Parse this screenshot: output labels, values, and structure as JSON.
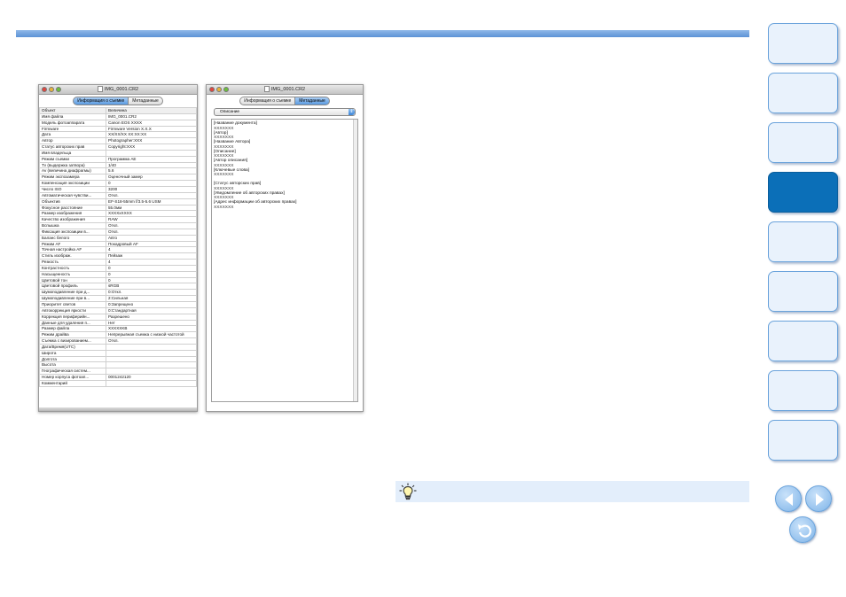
{
  "window1": {
    "title": "IMG_0001.CR2",
    "tabs": [
      "Информация о съемке",
      "Метаданные"
    ],
    "active_tab": 0,
    "columns": [
      "Объект",
      "Величина"
    ],
    "rows": [
      [
        "Имя файла",
        "IMG_0001.CR2"
      ],
      [
        "Модель фотоаппарата",
        "Canon EOS XXXX"
      ],
      [
        "Firmware",
        "Firmware Version X.X.X"
      ],
      [
        "Дата",
        "XX/XX/XX XX:XX:XX"
      ],
      [
        "Автор",
        "Photographer:XXX"
      ],
      [
        "Статус авторских прав",
        "Copyright:XXX"
      ],
      [
        "Имя владельца",
        ""
      ],
      [
        "Режим съемки",
        "Программа AE"
      ],
      [
        "Tv (выдержка затвора)",
        "1/40"
      ],
      [
        "Av (величина диафрагмы)",
        "5.6"
      ],
      [
        "Режим экспозамера",
        "Оценочный замер"
      ],
      [
        "Компенсация экспозиции",
        "0"
      ],
      [
        "Число ISO",
        "3200"
      ],
      [
        "Автоматическая чувстви...",
        "Откл."
      ],
      [
        "Объектив",
        "EF-S18-55mm f/3.5-5.6 USM"
      ],
      [
        "Фокусное расстояние",
        "55.0мм"
      ],
      [
        "Размер изображения",
        "XXXXxXXXX"
      ],
      [
        "Качество изображения",
        "RAW"
      ],
      [
        "Вспышка",
        "Откл."
      ],
      [
        "Фиксация экспозиции в...",
        "Откл."
      ],
      [
        "Баланс белого",
        "Авто"
      ],
      [
        "Режим AF",
        "Покадровый AF"
      ],
      [
        "Точная настройка AF",
        "4"
      ],
      [
        "Стиль изображ.",
        "Пейзаж"
      ],
      [
        "Резкость",
        "4"
      ],
      [
        "Контрастность",
        "0"
      ],
      [
        "Насыщенность",
        "0"
      ],
      [
        "Цветовой тон",
        "0"
      ],
      [
        "Цветовой профиль",
        "sRGB"
      ],
      [
        "Шумоподавление при д...",
        "0:Откл."
      ],
      [
        "Шумоподавление при в...",
        "2:Сильная"
      ],
      [
        "Приоритет светов",
        "0:Запрещено"
      ],
      [
        "Автокоррекция яркости",
        "0:Стандартная"
      ],
      [
        "Коррекция периферийн...",
        "Разрешено"
      ],
      [
        "Данные для удаления п...",
        "Нет"
      ],
      [
        "Размер файла",
        "XXXXXKB"
      ],
      [
        "Режим драйва",
        "Непрерывная съемка с низкой частотой"
      ],
      [
        "Съемка с визированием...",
        "Откл."
      ],
      [
        "Дата/Время(UTC)",
        ""
      ],
      [
        "Широта",
        ""
      ],
      [
        "Долгота",
        ""
      ],
      [
        "Высота",
        ""
      ],
      [
        "Географическая систем...",
        ""
      ],
      [
        "Номер корпуса фотоап...",
        "0001242120"
      ],
      [
        "Комментарий",
        ""
      ]
    ]
  },
  "window2": {
    "title": "IMG_0001.CR2",
    "tabs": [
      "Информация о съемке",
      "Метаданные"
    ],
    "active_tab": 1,
    "dropdown": "Описание",
    "fields": [
      {
        "label": "[Название документа]",
        "value": "XXXXXXX"
      },
      {
        "label": "[Автор]",
        "value": "XXXXXXX"
      },
      {
        "label": "[Название Автора]",
        "value": "XXXXXXX"
      },
      {
        "label": "[Описание]",
        "value": "XXXXXXX"
      },
      {
        "label": "[Автор описания]",
        "value": "XXXXXXX"
      },
      {
        "label": "[Ключевые слова]",
        "value": "XXXXXXX"
      },
      {
        "label": "[Статус авторских прав]",
        "value": "XXXXXXX",
        "gap": true
      },
      {
        "label": "[Уведомление об авторских правах]",
        "value": "XXXXXXX"
      },
      {
        "label": "[Адрес информации об авторских правах]",
        "value": "XXXXXXX"
      }
    ]
  },
  "colors": {
    "accent_bar": "#5c93d6",
    "nav_active": "#0b6fb8",
    "nav_idle": "#e9f2fc",
    "tip_bg": "#e3eefb"
  },
  "icons": {
    "tip": "lightbulb-icon",
    "prev": "arrow-left-icon",
    "next": "arrow-right-icon",
    "back": "return-icon"
  }
}
